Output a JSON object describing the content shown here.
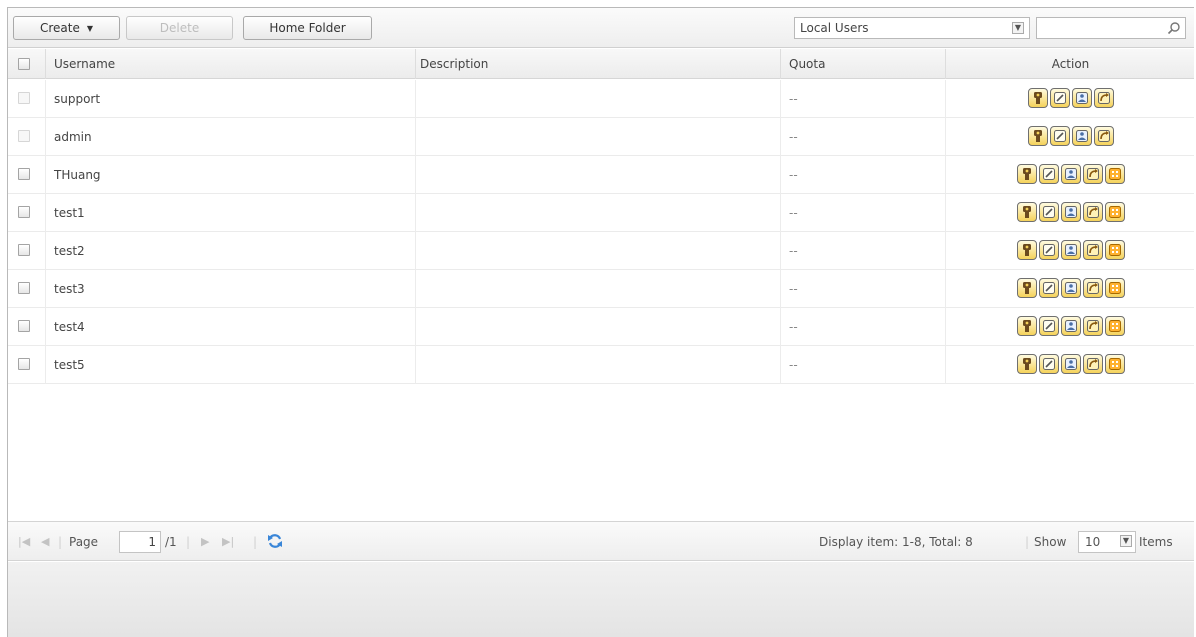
{
  "toolbar": {
    "create_label": "Create",
    "delete_label": "Delete",
    "home_folder_label": "Home Folder",
    "user_type_selected": "Local Users",
    "search_value": ""
  },
  "table": {
    "columns": [
      "Username",
      "Description",
      "Quota",
      "Action"
    ],
    "rows": [
      {
        "username": "support",
        "description": "",
        "quota": "--",
        "checkbox_enabled": false,
        "actions": [
          "password",
          "edit",
          "group",
          "share"
        ]
      },
      {
        "username": "admin",
        "description": "",
        "quota": "--",
        "checkbox_enabled": false,
        "actions": [
          "password",
          "edit",
          "group",
          "share"
        ]
      },
      {
        "username": "THuang",
        "description": "",
        "quota": "--",
        "checkbox_enabled": true,
        "actions": [
          "password",
          "edit",
          "group",
          "share",
          "app"
        ]
      },
      {
        "username": "test1",
        "description": "",
        "quota": "--",
        "checkbox_enabled": true,
        "actions": [
          "password",
          "edit",
          "group",
          "share",
          "app"
        ]
      },
      {
        "username": "test2",
        "description": "",
        "quota": "--",
        "checkbox_enabled": true,
        "actions": [
          "password",
          "edit",
          "group",
          "share",
          "app"
        ]
      },
      {
        "username": "test3",
        "description": "",
        "quota": "--",
        "checkbox_enabled": true,
        "actions": [
          "password",
          "edit",
          "group",
          "share",
          "app"
        ]
      },
      {
        "username": "test4",
        "description": "",
        "quota": "--",
        "checkbox_enabled": true,
        "actions": [
          "password",
          "edit",
          "group",
          "share",
          "app"
        ]
      },
      {
        "username": "test5",
        "description": "",
        "quota": "--",
        "checkbox_enabled": true,
        "actions": [
          "password",
          "edit",
          "group",
          "share",
          "app"
        ]
      }
    ]
  },
  "pager": {
    "page_label": "Page",
    "current_page": "1",
    "total_pages_label": "/1",
    "display_info": "Display item: 1-8, Total: 8",
    "show_label": "Show",
    "show_value": "10",
    "items_label": "Items"
  },
  "icons": {
    "first_page": "first-page-icon",
    "prev_page": "prev-page-icon",
    "next_page": "next-page-icon",
    "last_page": "last-page-icon",
    "refresh": "refresh-icon",
    "search": "search-icon",
    "dropdown": "dropdown-arrow-icon"
  },
  "colors": {
    "action_icon_bg": "#f5d25a",
    "refresh_icon": "#3a86d8"
  }
}
